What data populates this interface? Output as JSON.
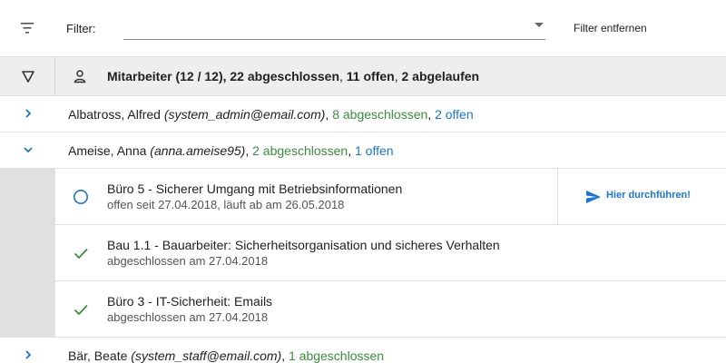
{
  "filter_bar": {
    "label": "Filter:",
    "input_value": "",
    "remove_label": "Filter entfernen"
  },
  "header": {
    "title": "Mitarbeiter (12 / 12), ",
    "completed": "22 abgeschlossen",
    "sep1": ", ",
    "open": "11 offen",
    "sep2": ", ",
    "expired": "2 abgelaufen"
  },
  "users": [
    {
      "name": "Albatross, Alfred ",
      "account": "(system_admin@email.com)",
      "sep1": ", ",
      "completed": "8 abgeschlossen",
      "sep2": ", ",
      "open": "2 offen",
      "expanded": false
    },
    {
      "name": "Ameise, Anna ",
      "account": "(anna.ameise95)",
      "sep1": ", ",
      "completed": "2 abgeschlossen",
      "sep2": ", ",
      "open": "1 offen",
      "expanded": true,
      "courses": [
        {
          "title": "Büro 5 - Sicherer Umgang mit Betriebsinformationen",
          "subtitle": "offen seit 27.04.2018, läuft ab am 26.05.2018",
          "status": "open",
          "action_label": "Hier durchführen!"
        },
        {
          "title": "Bau 1.1 - Bauarbeiter: Sicherheitsorganisation und sicheres Verhalten",
          "subtitle": "abgeschlossen am 27.04.2018",
          "status": "completed"
        },
        {
          "title": "Büro 3 - IT-Sicherheit: Emails",
          "subtitle": "abgeschlossen am 27.04.2018",
          "status": "completed"
        }
      ]
    },
    {
      "name": "Bär, Beate ",
      "account": "(system_staff@email.com)",
      "sep1": ", ",
      "completed": "1 abgeschlossen",
      "expanded": false
    }
  ],
  "colors": {
    "completed": "#388e3c",
    "open": "#1976d2",
    "expired": "#d32f2f",
    "accent": "#1976d2"
  }
}
